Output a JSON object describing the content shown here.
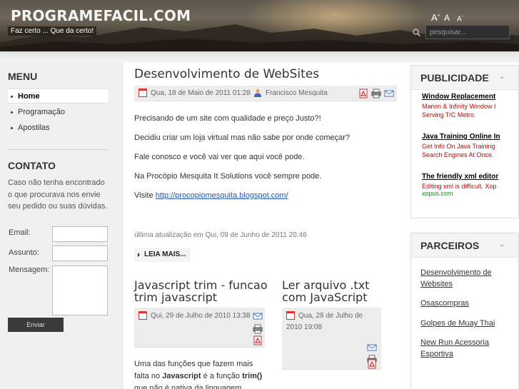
{
  "header": {
    "site_title": "PROGRAMEFACIL.COM",
    "slogan": "Faz certo ... Que da certo!",
    "font_increase": "A",
    "font_reset": "A",
    "font_decrease": "A",
    "font_increase_mark": "+",
    "font_decrease_mark": "-",
    "search_placeholder": "pesquisar..."
  },
  "left": {
    "menu_title": "MENU",
    "menu_items": [
      {
        "label": "Home",
        "active": true
      },
      {
        "label": "Programação",
        "active": false
      },
      {
        "label": "Apostilas",
        "active": false
      }
    ],
    "contact_title": "CONTATO",
    "contact_text": "Caso não tenha encontrado o que procurava nos envie seu pedido ou suas dúvidas.",
    "email_label": "Email:",
    "subject_label": "Assunto:",
    "message_label": "Mensagem:",
    "send_label": "Enviar"
  },
  "main": {
    "article1": {
      "title": "Desenvolvimento de WebSites",
      "date": "Qua, 18 de Maio de 2011 01:28",
      "author": "Francisco Mesquita",
      "paragraphs": [
        "Precisando de um site com qualidade e preço Justo?!",
        "Decidiu criar um loja virtual mas não sabe por onde começar?",
        "Fale conosco e você vai ver que aqui você pode.",
        "Na Procópio Mesquita It Solutions você sempre pode."
      ],
      "visit_label": "Visite",
      "link": "http://procopiomesquita.blogspot.com/",
      "updated": "última atualização em Qui, 09 de Junho de 2011 20:46",
      "read_more": "LEIA MAIS..."
    },
    "article2": {
      "title_line1": "Javascript trim - funcao",
      "title_line2": "trim javascript",
      "date": "Qui, 29 de Julho de 2010 13:38",
      "text_line1": "Uma das funções que fazem mais",
      "text_line2_a": "falta no ",
      "text_line2_b": "Javascript",
      "text_line2_c": " é a função ",
      "text_line2_d": "trim()",
      "text_line3": "que não é nativa da linguagem."
    },
    "article3": {
      "title_line1": "Ler arquivo .txt",
      "title_line2": "com JavaScript",
      "date_line1": "Qua, 28 de Julho de",
      "date_line2": "2010 19:08"
    }
  },
  "right": {
    "ads_title": "PUBLICIDADE",
    "ads": [
      {
        "title": "Window Replacement",
        "line1": "Marvin & Infinity Window I",
        "line2": "Serving T/C Metro.",
        "url": ""
      },
      {
        "title": "Java Training Online In",
        "line1": "Get Info On Java Training",
        "line2": "Search Engines At Once.",
        "url": ""
      },
      {
        "title": "The friendly xml editor",
        "line1": "Editing xml is difficult. Xop",
        "line2": "",
        "url": "xopus.com"
      }
    ],
    "partners_title": "PARCEIROS",
    "partners": [
      {
        "line1": "Desenvolvimento de",
        "line2": "Websites"
      },
      {
        "line1": "Osascompras",
        "line2": ""
      },
      {
        "line1": "Golpes de Muay Thai",
        "line2": ""
      },
      {
        "line1": "New Run Acessoria",
        "line2": "Esportiva"
      }
    ]
  },
  "colors": {
    "link": "#2255aa",
    "ad_text": "#cc0000",
    "ad_url": "#009900"
  }
}
